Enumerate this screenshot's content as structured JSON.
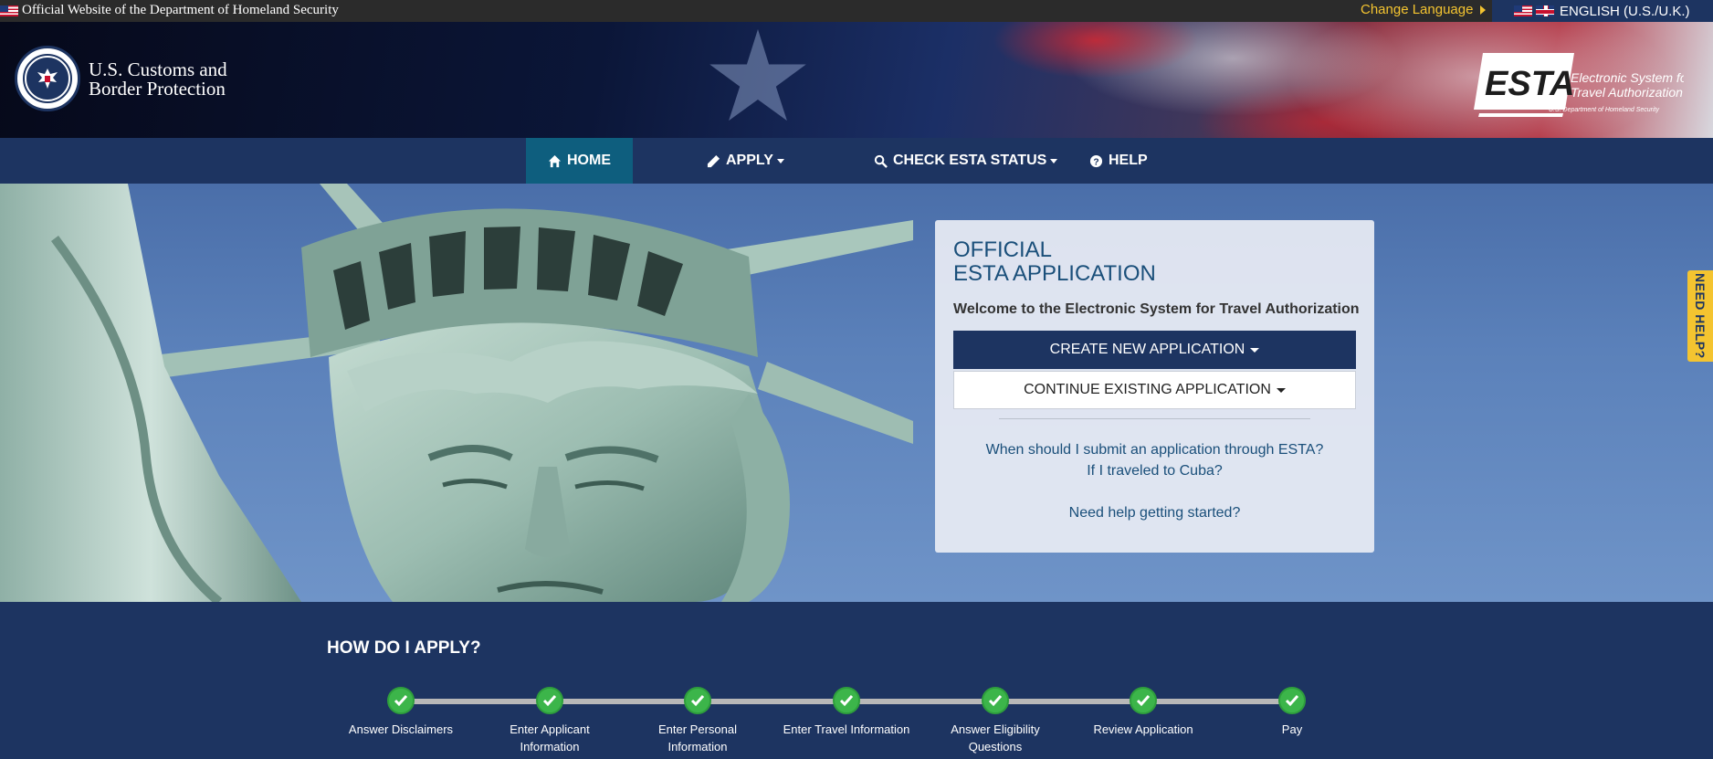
{
  "topbar": {
    "official_text": "Official Website of the Department of Homeland Security",
    "change_language": "Change Language",
    "language": "ENGLISH (U.S./U.K.)"
  },
  "header": {
    "agency_line1": "U.S. Customs and",
    "agency_line2": "Border Protection",
    "esta_logo_word": "ESTA",
    "esta_logo_line1": "Electronic System for",
    "esta_logo_line2": "Travel Authorization",
    "esta_logo_line3": "U.S. Department of Homeland Security"
  },
  "nav": {
    "items": [
      {
        "label": "HOME",
        "icon": "home-icon",
        "active": true
      },
      {
        "label": "APPLY",
        "icon": "pencil-icon",
        "dropdown": true
      },
      {
        "label": "CHECK ESTA STATUS",
        "icon": "search-icon",
        "dropdown": true
      },
      {
        "label": "HELP",
        "icon": "question-circle-icon"
      }
    ]
  },
  "card": {
    "title_line1": "OFFICIAL",
    "title_line2": "ESTA APPLICATION",
    "welcome": "Welcome to the Electronic System for Travel Authorization",
    "create_button": "CREATE NEW APPLICATION",
    "continue_button": "CONTINUE EXISTING APPLICATION",
    "link_when": "When should I submit an application through ESTA?",
    "link_cuba": "If I traveled to Cuba?",
    "link_help": "Need help getting started?"
  },
  "need_help_tab": "NEED HELP?",
  "how": {
    "title": "HOW DO I APPLY?",
    "steps": [
      {
        "line1": "Answer Disclaimers",
        "line2": ""
      },
      {
        "line1": "Enter Applicant",
        "line2": "Information"
      },
      {
        "line1": "Enter Personal",
        "line2": "Information"
      },
      {
        "line1": "Enter Travel Information",
        "line2": ""
      },
      {
        "line1": "Answer Eligibility",
        "line2": "Questions"
      },
      {
        "line1": "Review Application",
        "line2": ""
      },
      {
        "line1": "Pay",
        "line2": ""
      }
    ]
  },
  "colors": {
    "navy": "#1d3461",
    "nav_active": "#0e5e7e",
    "accent_yellow": "#f4c430",
    "link_blue": "#1a4f7a",
    "step_green": "#3cb54a"
  }
}
